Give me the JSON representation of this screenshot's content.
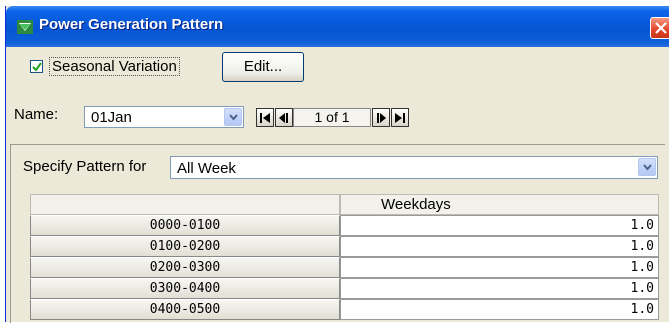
{
  "window": {
    "title": "Power Generation Pattern"
  },
  "seasonal": {
    "checked": true,
    "label": "Seasonal Variation",
    "edit_label": "Edit..."
  },
  "name": {
    "label": "Name:",
    "value": "01Jan",
    "record_indicator": "1 of 1"
  },
  "pattern": {
    "label": "Specify Pattern for",
    "value": "All Week"
  },
  "table": {
    "column_header": "Weekdays",
    "rows": [
      {
        "period": "0000-0100",
        "value": "1.0"
      },
      {
        "period": "0100-0200",
        "value": "1.0"
      },
      {
        "period": "0200-0300",
        "value": "1.0"
      },
      {
        "period": "0300-0400",
        "value": "1.0"
      },
      {
        "period": "0400-0500",
        "value": "1.0"
      }
    ]
  },
  "colors": {
    "titlebar": "#0655d4",
    "close": "#e0442a",
    "dialog": "#ece9d8"
  }
}
